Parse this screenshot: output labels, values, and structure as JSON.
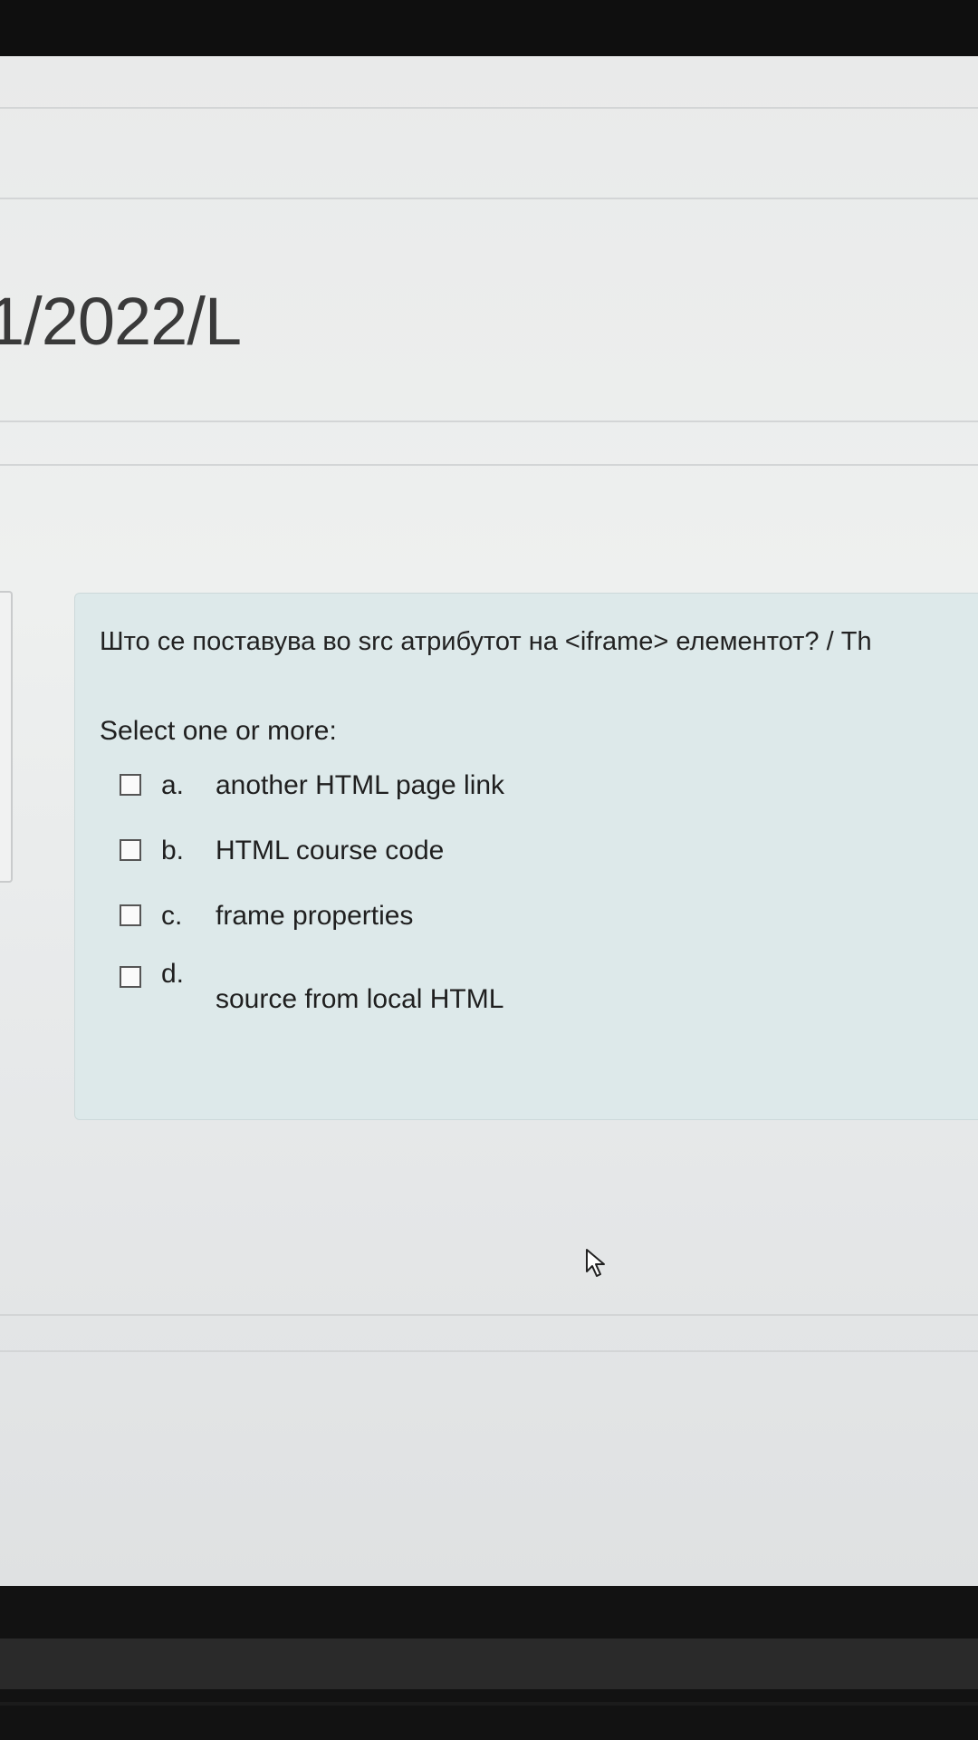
{
  "course": {
    "title_fragment": "1/2022/L"
  },
  "question": {
    "text": "Што се поставува во src атрибутот на <iframe> елементот? / Th",
    "prompt": "Select one or more:",
    "options": [
      {
        "letter": "a.",
        "label": "another HTML page link",
        "checked": false
      },
      {
        "letter": "b.",
        "label": "HTML course code",
        "checked": false
      },
      {
        "letter": "c.",
        "label": "frame properties",
        "checked": false
      },
      {
        "letter": "d.",
        "label": "source from local HTML",
        "checked": false
      }
    ]
  },
  "icons": {
    "cursor": "mouse-pointer-icon"
  },
  "colors": {
    "question_background": "#dde9ea",
    "page_background": "#ececec"
  }
}
